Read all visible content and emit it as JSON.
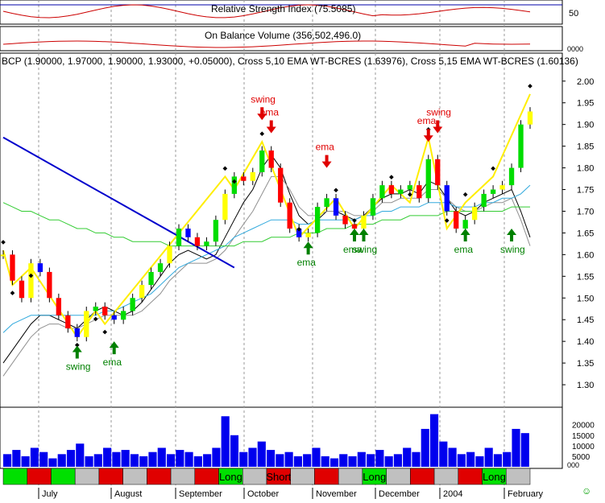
{
  "panels": {
    "rsi": {
      "label": "Relative Strength Index (75.5085)",
      "ticks": [
        "50"
      ]
    },
    "obv": {
      "label": "On Balance Volume (356,502,496.0)",
      "tick": "0000"
    },
    "main": {
      "header": "BCP (1.90000, 1.97000, 1.90000, 1.93000, +0.05000), Cross 5,10 EMA WT-BCRES (1.63976), Cross 5,15 EMA WT-BCRES (1.60136)"
    },
    "volume": {
      "ticks": [
        "20000",
        "15000",
        "10000",
        "5000"
      ],
      "bottom_tick": "000"
    }
  },
  "annotations": [
    {
      "text": "swing",
      "color": "#008000",
      "dir": "up",
      "index": 8,
      "price": 1.39
    },
    {
      "text": "ema",
      "color": "#008000",
      "dir": "up",
      "index": 12,
      "price": 1.4
    },
    {
      "text": "swing",
      "color": "#e00000",
      "dir": "down",
      "index": 28,
      "price": 1.91
    },
    {
      "text": "ema",
      "color": "#e00000",
      "dir": "down",
      "index": 29,
      "price": 1.88
    },
    {
      "text": "ema",
      "color": "#e00000",
      "dir": "down",
      "index": 35,
      "price": 1.8
    },
    {
      "text": "ema",
      "color": "#008000",
      "dir": "up",
      "index": 33,
      "price": 1.63
    },
    {
      "text": "ema",
      "color": "#008000",
      "dir": "up",
      "index": 38,
      "price": 1.66
    },
    {
      "text": "swing",
      "color": "#008000",
      "dir": "up",
      "index": 39,
      "price": 1.66
    },
    {
      "text": "swing",
      "color": "#e00000",
      "dir": "down",
      "index": 47,
      "price": 1.88
    },
    {
      "text": "ema",
      "color": "#e00000",
      "dir": "down",
      "index": 46,
      "price": 1.86
    },
    {
      "text": "ema",
      "color": "#008000",
      "dir": "up",
      "index": 50,
      "price": 1.66
    },
    {
      "text": "swing",
      "color": "#008000",
      "dir": "up",
      "index": 55,
      "price": 1.66
    }
  ],
  "signals": [
    {
      "color": "#00e000"
    },
    {
      "color": "#e00000"
    },
    {
      "color": "#00e000"
    },
    {
      "color": "#c0c0c0"
    },
    {
      "color": "#e00000"
    },
    {
      "color": "#c0c0c0"
    },
    {
      "color": "#e00000"
    },
    {
      "color": "#c0c0c0"
    },
    {
      "color": "#e00000"
    },
    {
      "color": "#00e000",
      "label": "Long"
    },
    {
      "color": "#c0c0c0"
    },
    {
      "color": "#e00000",
      "label": "Short"
    },
    {
      "color": "#c0c0c0"
    },
    {
      "color": "#e00000"
    },
    {
      "color": "#c0c0c0"
    },
    {
      "color": "#00e000",
      "label": "Long"
    },
    {
      "color": "#c0c0c0"
    },
    {
      "color": "#e00000"
    },
    {
      "color": "#c0c0c0"
    },
    {
      "color": "#e00000"
    },
    {
      "color": "#00e000",
      "label": "Long"
    },
    {
      "color": "#c0c0c0"
    }
  ],
  "smiley": "☺",
  "chart_data": {
    "type": "line",
    "title": "BCP (1.90000, 1.97000, 1.90000, 1.93000, +0.05000), Cross 5,10 EMA WT-BCRES (1.63976), Cross 5,15 EMA WT-BCRES (1.60136)",
    "x_tick_labels": [
      "July",
      "August",
      "September",
      "October",
      "November",
      "December",
      "2004",
      "February"
    ],
    "y_tick_labels": [
      "2.00",
      "1.95",
      "1.90",
      "1.85",
      "1.80",
      "1.75",
      "1.70",
      "1.65",
      "1.60",
      "1.55",
      "1.50",
      "1.45",
      "1.40",
      "1.35",
      "1.30"
    ],
    "ylim": [
      1.25,
      2.02
    ],
    "close": [
      1.6,
      1.54,
      1.5,
      1.58,
      1.56,
      1.5,
      1.46,
      1.43,
      1.41,
      1.47,
      1.48,
      1.46,
      1.45,
      1.47,
      1.5,
      1.53,
      1.56,
      1.58,
      1.62,
      1.66,
      1.64,
      1.62,
      1.63,
      1.68,
      1.74,
      1.78,
      1.77,
      1.79,
      1.84,
      1.8,
      1.72,
      1.66,
      1.64,
      1.65,
      1.71,
      1.73,
      1.69,
      1.67,
      1.66,
      1.69,
      1.73,
      1.76,
      1.74,
      1.75,
      1.76,
      1.73,
      1.82,
      1.76,
      1.7,
      1.66,
      1.68,
      1.71,
      1.74,
      1.75,
      1.76,
      1.8,
      1.9,
      1.93
    ],
    "series": [
      {
        "name": "Cross 5,10 EMA WT-BCRES",
        "color": "#000000",
        "values": [
          1.35,
          1.38,
          1.41,
          1.44,
          1.46,
          1.46,
          1.45,
          1.44,
          1.43,
          1.45,
          1.47,
          1.48,
          1.47,
          1.46,
          1.47,
          1.49,
          1.52,
          1.55,
          1.58,
          1.6,
          1.61,
          1.6,
          1.59,
          1.6,
          1.64,
          1.68,
          1.72,
          1.75,
          1.8,
          1.83,
          1.8,
          1.74,
          1.69,
          1.67,
          1.68,
          1.7,
          1.7,
          1.69,
          1.68,
          1.69,
          1.71,
          1.73,
          1.74,
          1.74,
          1.75,
          1.74,
          1.77,
          1.76,
          1.73,
          1.7,
          1.69,
          1.7,
          1.72,
          1.73,
          1.74,
          1.75,
          1.7,
          1.64
        ]
      },
      {
        "name": "Cross 5,15 EMA WT-BCRES",
        "color": "#909090",
        "values": [
          1.32,
          1.35,
          1.38,
          1.41,
          1.43,
          1.44,
          1.44,
          1.43,
          1.43,
          1.44,
          1.45,
          1.46,
          1.46,
          1.46,
          1.46,
          1.47,
          1.49,
          1.51,
          1.54,
          1.56,
          1.58,
          1.58,
          1.58,
          1.59,
          1.61,
          1.64,
          1.67,
          1.7,
          1.74,
          1.78,
          1.78,
          1.75,
          1.71,
          1.69,
          1.69,
          1.7,
          1.7,
          1.7,
          1.69,
          1.69,
          1.7,
          1.72,
          1.72,
          1.73,
          1.73,
          1.73,
          1.75,
          1.75,
          1.73,
          1.71,
          1.7,
          1.7,
          1.71,
          1.72,
          1.72,
          1.73,
          1.68,
          1.62
        ]
      },
      {
        "name": "EMA",
        "color": "#33aadd",
        "values": [
          1.42,
          1.44,
          1.45,
          1.46,
          1.46,
          1.46,
          1.46,
          1.46,
          1.46,
          1.46,
          1.46,
          1.47,
          1.47,
          1.48,
          1.49,
          1.5,
          1.51,
          1.53,
          1.55,
          1.57,
          1.58,
          1.59,
          1.6,
          1.61,
          1.62,
          1.64,
          1.65,
          1.66,
          1.67,
          1.68,
          1.68,
          1.68,
          1.67,
          1.67,
          1.68,
          1.68,
          1.68,
          1.68,
          1.68,
          1.69,
          1.69,
          1.7,
          1.7,
          1.71,
          1.71,
          1.71,
          1.72,
          1.72,
          1.72,
          1.71,
          1.71,
          1.71,
          1.72,
          1.72,
          1.73,
          1.73,
          1.74,
          1.76
        ]
      },
      {
        "name": "Moving Average",
        "color": "#33cc33",
        "values": [
          1.72,
          1.71,
          1.7,
          1.7,
          1.69,
          1.68,
          1.68,
          1.67,
          1.66,
          1.66,
          1.65,
          1.65,
          1.64,
          1.64,
          1.63,
          1.63,
          1.63,
          1.63,
          1.62,
          1.62,
          1.62,
          1.62,
          1.62,
          1.62,
          1.62,
          1.62,
          1.63,
          1.63,
          1.63,
          1.64,
          1.64,
          1.64,
          1.65,
          1.65,
          1.65,
          1.66,
          1.66,
          1.66,
          1.67,
          1.67,
          1.67,
          1.68,
          1.68,
          1.68,
          1.69,
          1.69,
          1.69,
          1.69,
          1.7,
          1.7,
          1.7,
          1.7,
          1.7,
          1.7,
          1.7,
          1.71,
          1.71,
          1.71
        ]
      },
      {
        "name": "Swing",
        "color": "#ffee00",
        "points": [
          [
            0,
            1.61
          ],
          [
            1,
            1.53
          ],
          [
            3,
            1.57
          ],
          [
            8,
            1.41
          ],
          [
            10,
            1.47
          ],
          [
            11,
            1.44
          ],
          [
            24,
            1.78
          ],
          [
            25,
            1.75
          ],
          [
            28,
            1.86
          ],
          [
            32,
            1.64
          ],
          [
            36,
            1.73
          ],
          [
            38,
            1.66
          ],
          [
            42,
            1.76
          ],
          [
            44,
            1.72
          ],
          [
            46,
            1.87
          ],
          [
            48,
            1.66
          ],
          [
            50,
            1.72
          ],
          [
            53,
            1.78
          ],
          [
            57,
            1.97
          ]
        ]
      },
      {
        "name": "Trend line",
        "color": "#0000cc",
        "points": [
          [
            0,
            1.87
          ],
          [
            25,
            1.57
          ]
        ]
      }
    ],
    "volume": [
      6000,
      8000,
      5000,
      9000,
      7000,
      4000,
      6000,
      8000,
      11000,
      5000,
      6000,
      9000,
      7000,
      8000,
      6000,
      5000,
      7000,
      9000,
      6000,
      8000,
      7000,
      5000,
      6000,
      9000,
      24000,
      15000,
      7000,
      9000,
      12000,
      8000,
      6000,
      7000,
      5000,
      6000,
      9000,
      5000,
      4000,
      6000,
      5000,
      7000,
      6000,
      8000,
      5000,
      6000,
      9000,
      7000,
      18000,
      25000,
      12000,
      9000,
      6000,
      7000,
      5000,
      9000,
      6000,
      7000,
      18000,
      16000
    ]
  }
}
